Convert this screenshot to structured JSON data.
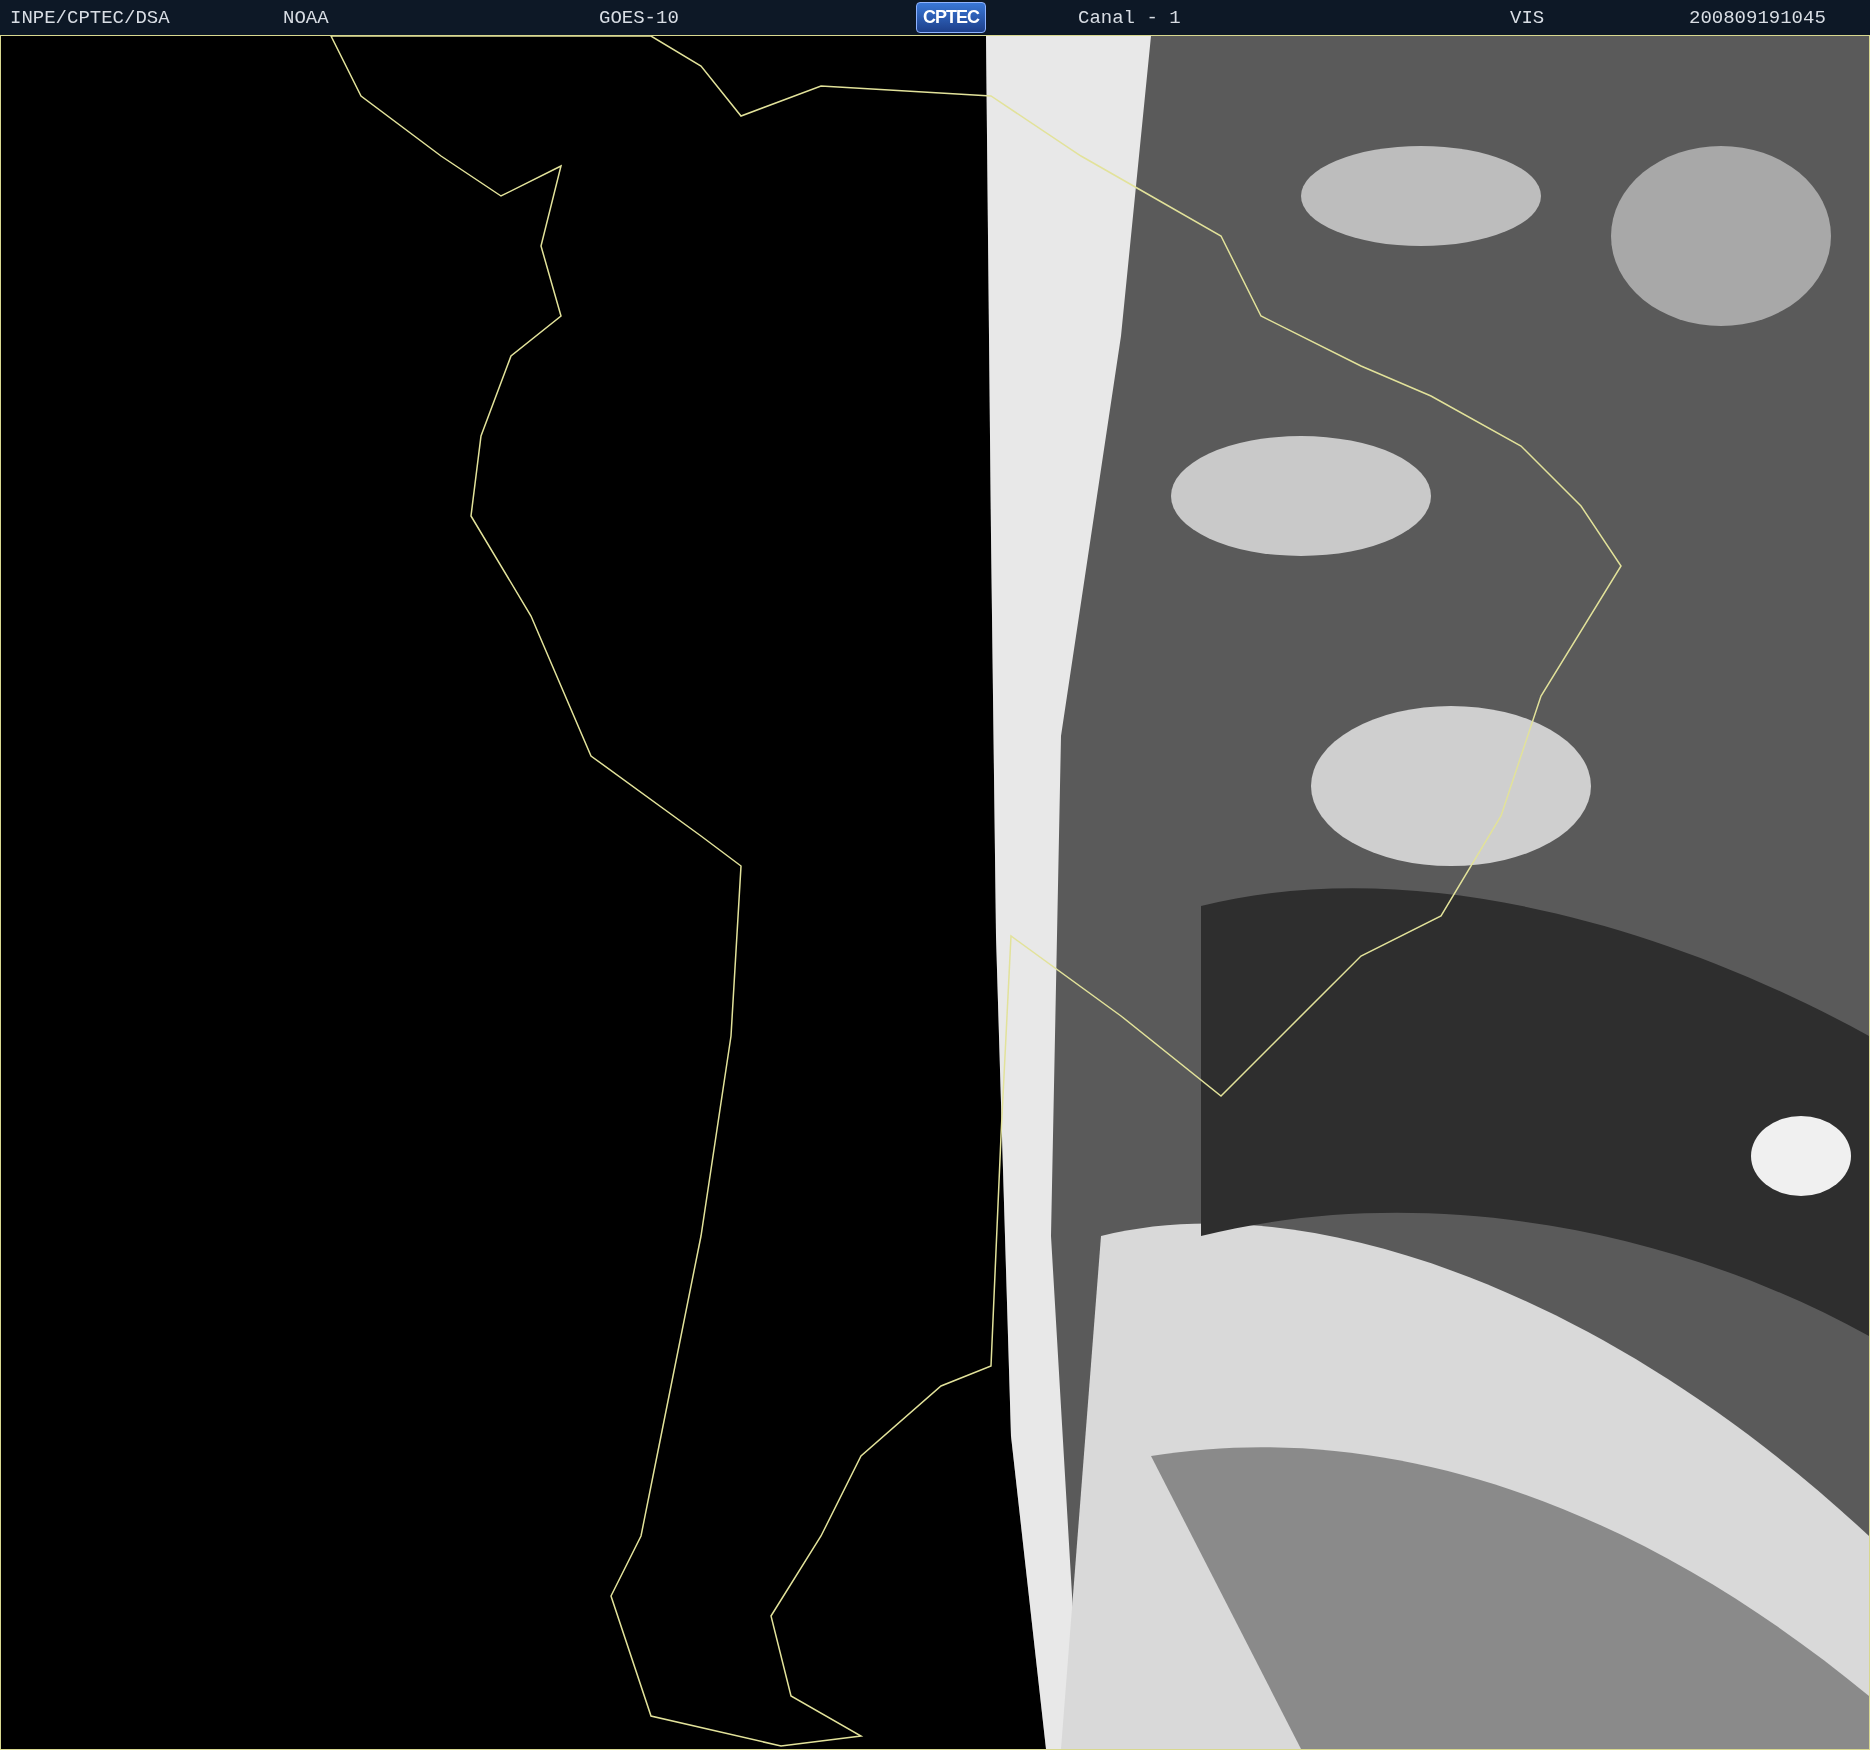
{
  "header": {
    "items": [
      {
        "kind": "text",
        "text": "INPE/CPTEC/DSA"
      },
      {
        "kind": "text",
        "text": "NOAA"
      },
      {
        "kind": "text",
        "text": "GOES-10"
      },
      {
        "kind": "logo",
        "text": "CPTEC"
      },
      {
        "kind": "text",
        "text": "Canal - 1"
      },
      {
        "kind": "text",
        "text": "VIS"
      },
      {
        "kind": "text",
        "text": "200809191045"
      }
    ]
  }
}
